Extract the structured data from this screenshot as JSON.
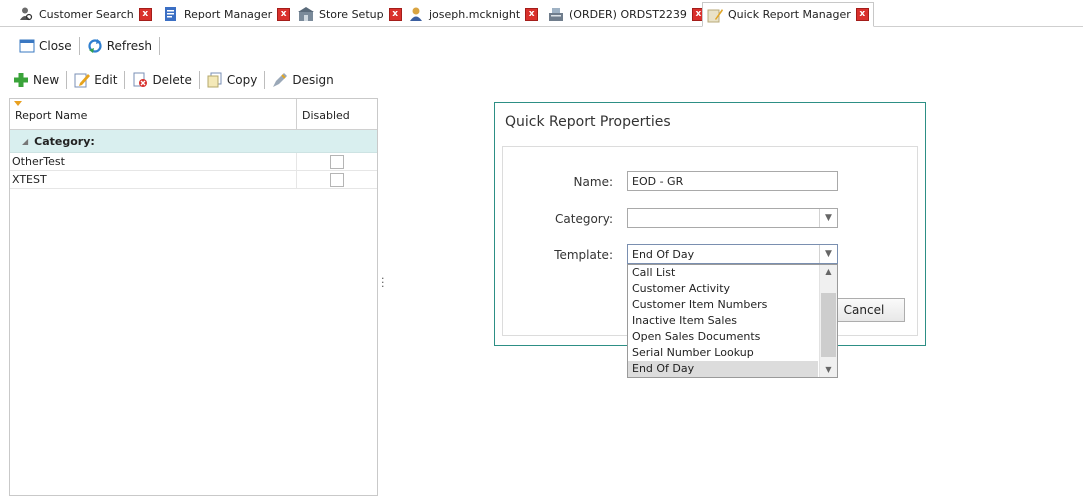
{
  "tabs": [
    {
      "label": "Customer Search",
      "icon": "person-search-icon"
    },
    {
      "label": "Report Manager",
      "icon": "report-icon"
    },
    {
      "label": "Store Setup",
      "icon": "store-icon"
    },
    {
      "label": "joseph.mcknight",
      "icon": "user-icon"
    },
    {
      "label": "(ORDER) ORDST2239",
      "icon": "register-icon"
    },
    {
      "label": "Quick Report Manager",
      "icon": "pencil-report-icon",
      "active": true
    }
  ],
  "toolbar": {
    "close_label": "Close",
    "refresh_label": "Refresh"
  },
  "actions": {
    "new_label": "New",
    "edit_label": "Edit",
    "delete_label": "Delete",
    "copy_label": "Copy",
    "design_label": "Design"
  },
  "grid": {
    "col_name": "Report Name",
    "col_disabled": "Disabled",
    "category_label": "Category:",
    "rows": [
      {
        "name": "OtherTest",
        "disabled": false
      },
      {
        "name": "XTEST",
        "disabled": false
      }
    ]
  },
  "dialog": {
    "title": "Quick Report Properties",
    "name_label": "Name:",
    "name_value": "EOD - GR",
    "category_label": "Category:",
    "category_value": "",
    "template_label": "Template:",
    "template_value": "End Of Day",
    "cancel_label": "Cancel",
    "template_options": [
      "Call List",
      "Customer Activity",
      "Customer Item Numbers",
      "Inactive Item Sales",
      "Open Sales Documents",
      "Serial Number Lookup",
      "End Of Day"
    ],
    "selected_option": "End Of Day"
  },
  "colors": {
    "accent": "#2d8f85",
    "category_row": "#d9efef",
    "close_tab": "#d9302c"
  }
}
